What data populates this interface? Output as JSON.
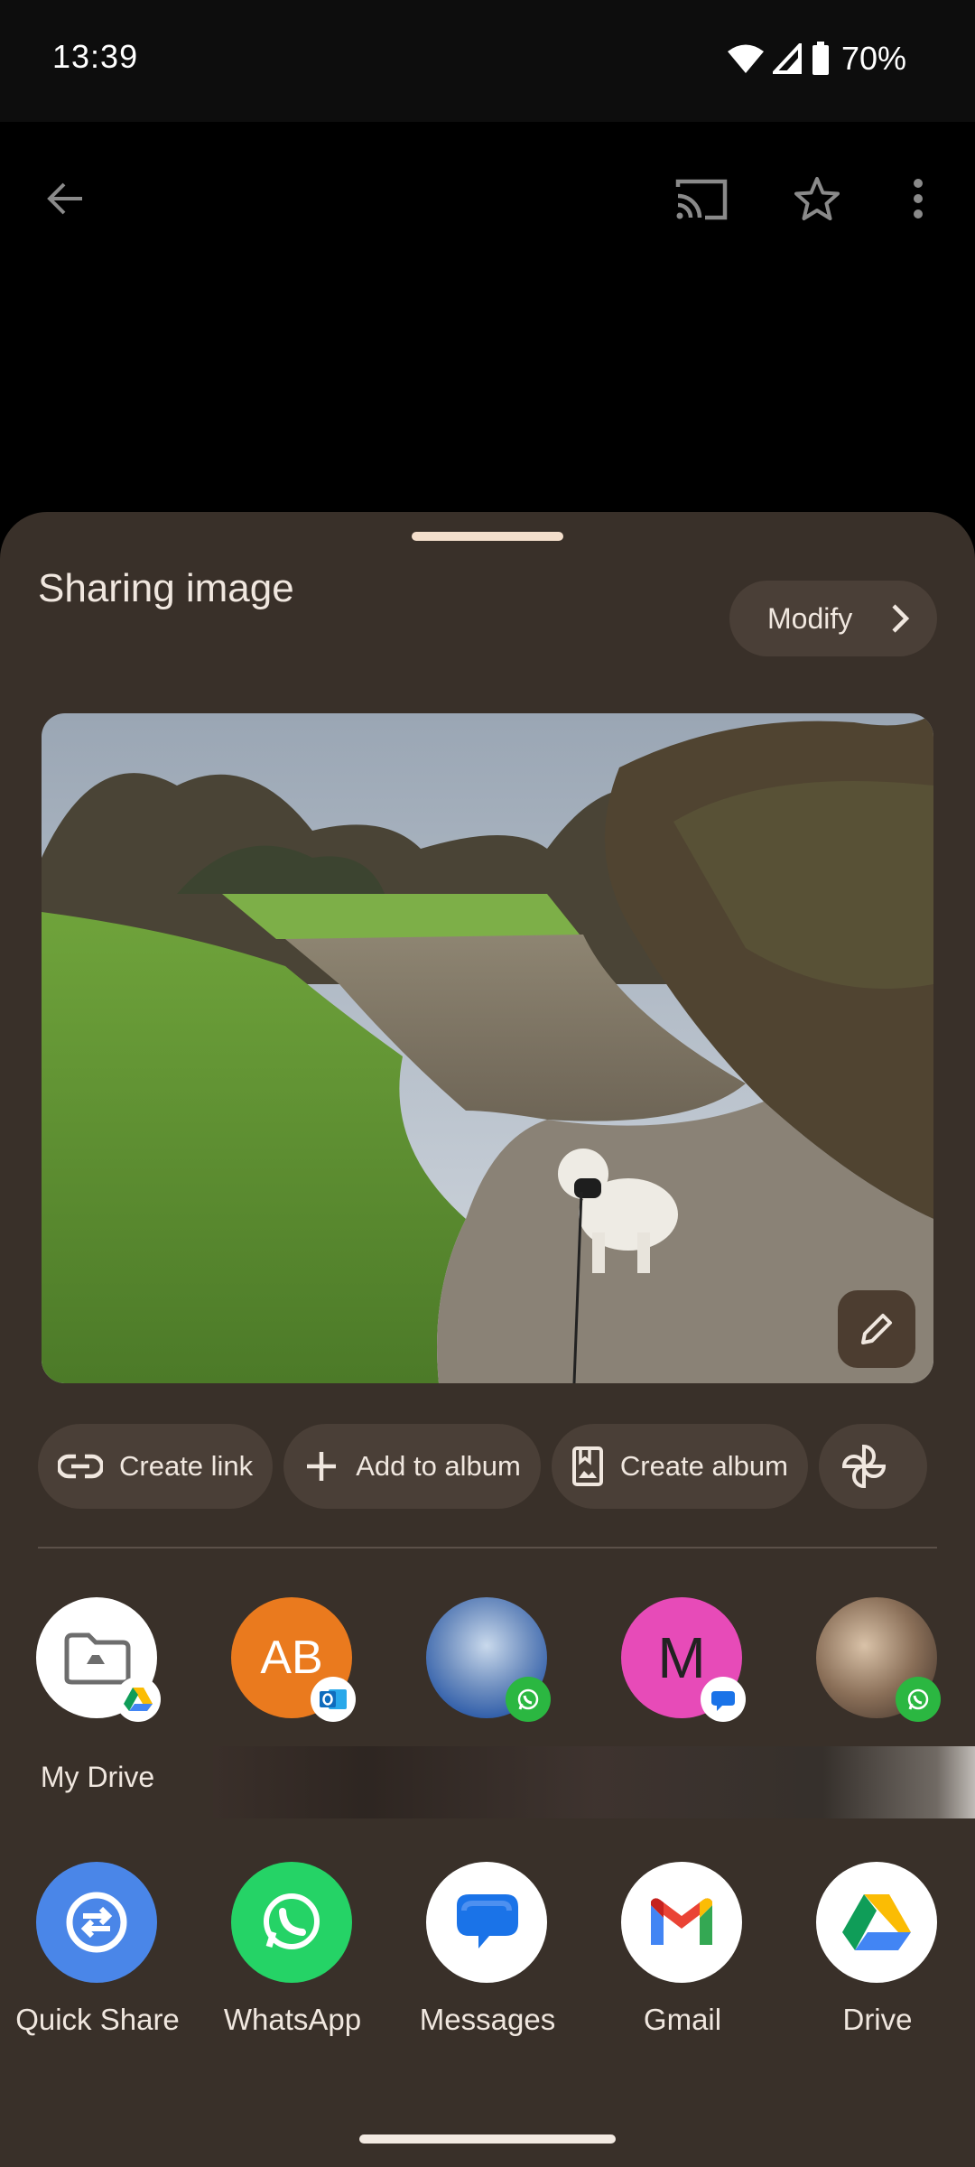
{
  "status": {
    "time": "13:39",
    "battery": "70%"
  },
  "top_bar": {
    "icons": [
      "back-arrow-icon",
      "cast-icon",
      "star-icon",
      "more-vert-icon"
    ]
  },
  "sheet": {
    "title": "Sharing image",
    "modify_label": "Modify"
  },
  "actions": [
    {
      "label": "Create link",
      "icon": "link-icon"
    },
    {
      "label": "Add to album",
      "icon": "plus-icon"
    },
    {
      "label": "Create album",
      "icon": "album-icon"
    },
    {
      "label": "",
      "icon": "pinwheel-icon"
    }
  ],
  "contacts": [
    {
      "name": "My Drive",
      "initials": "",
      "badge": "google-drive-badge"
    },
    {
      "name": "",
      "initials": "AB",
      "badge": "outlook-badge",
      "color": "#EA7A1E"
    },
    {
      "name": "",
      "initials": "",
      "badge": "whatsapp-badge"
    },
    {
      "name": "",
      "initials": "M",
      "badge": "messages-badge",
      "color": "#E74BB8"
    },
    {
      "name": "",
      "initials": "",
      "badge": "whatsapp-badge"
    }
  ],
  "apps": [
    {
      "label": "Quick Share",
      "icon": "quick-share-icon"
    },
    {
      "label": "WhatsApp",
      "icon": "whatsapp-icon"
    },
    {
      "label": "Messages",
      "icon": "messages-icon"
    },
    {
      "label": "Gmail",
      "icon": "gmail-icon"
    },
    {
      "label": "Drive",
      "icon": "drive-icon"
    }
  ]
}
